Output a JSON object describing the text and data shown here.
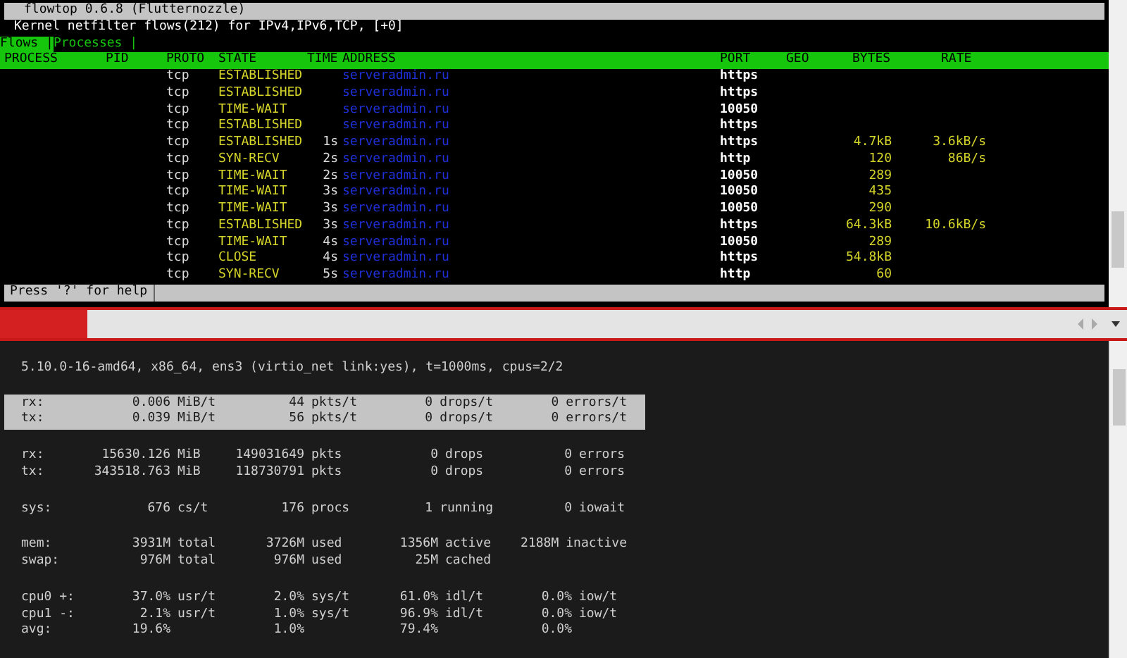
{
  "flowtop": {
    "title": "flowtop 0.6.8 (Flutternozzle)",
    "subtitle": "Kernel netfilter flows(212) for IPv4,IPv6,TCP, [+0]",
    "tabs": [
      {
        "label": "Flows |",
        "selected": true
      },
      {
        "label": "Processes |",
        "selected": false
      }
    ],
    "columns": [
      "PROCESS",
      "PID",
      "PROTO",
      "STATE",
      "TIME",
      "ADDRESS",
      "PORT",
      "GEO",
      "BYTES",
      "RATE"
    ],
    "rows": [
      {
        "proto": "tcp",
        "state": "ESTABLISHED",
        "address": "serveradmin.ru",
        "port": "https"
      },
      {
        "proto": "tcp",
        "state": "ESTABLISHED",
        "address": "serveradmin.ru",
        "port": "https"
      },
      {
        "proto": "tcp",
        "state": "TIME-WAIT",
        "address": "serveradmin.ru",
        "port": "10050"
      },
      {
        "proto": "tcp",
        "state": "ESTABLISHED",
        "address": "serveradmin.ru",
        "port": "https"
      },
      {
        "proto": "tcp",
        "state": "ESTABLISHED",
        "time": "1s",
        "address": "serveradmin.ru",
        "port": "https",
        "bytes": "4.7kB",
        "rate": "3.6kB/s"
      },
      {
        "proto": "tcp",
        "state": "SYN-RECV",
        "time": "2s",
        "address": "serveradmin.ru",
        "port": "http",
        "bytes": "120",
        "rate": "86B/s"
      },
      {
        "proto": "tcp",
        "state": "TIME-WAIT",
        "time": "2s",
        "address": "serveradmin.ru",
        "port": "10050",
        "bytes": "289"
      },
      {
        "proto": "tcp",
        "state": "TIME-WAIT",
        "time": "3s",
        "address": "serveradmin.ru",
        "port": "10050",
        "bytes": "435"
      },
      {
        "proto": "tcp",
        "state": "TIME-WAIT",
        "time": "3s",
        "address": "serveradmin.ru",
        "port": "10050",
        "bytes": "290"
      },
      {
        "proto": "tcp",
        "state": "ESTABLISHED",
        "time": "3s",
        "address": "serveradmin.ru",
        "port": "https",
        "bytes": "64.3kB",
        "rate": "10.6kB/s"
      },
      {
        "proto": "tcp",
        "state": "TIME-WAIT",
        "time": "4s",
        "address": "serveradmin.ru",
        "port": "10050",
        "bytes": "289"
      },
      {
        "proto": "tcp",
        "state": "CLOSE",
        "time": "4s",
        "address": "serveradmin.ru",
        "port": "https",
        "bytes": "54.8kB"
      },
      {
        "proto": "tcp",
        "state": "SYN-RECV",
        "time": "5s",
        "address": "serveradmin.ru",
        "port": "http",
        "bytes": "60"
      }
    ],
    "status": "Press '?' for help"
  },
  "ifpps": {
    "info": "5.10.0-16-amd64, x86_64, ens3 (virtio_net link:yes), t=1000ms, cpus=2/2",
    "groups": [
      {
        "highlighted": true,
        "rows": [
          {
            "label": "rx:",
            "cells": [
              {
                "value": "0.006",
                "unit": "MiB/t"
              },
              {
                "value": "44",
                "unit": "pkts/t"
              },
              {
                "value": "0",
                "unit": "drops/t"
              },
              {
                "value": "0",
                "unit": "errors/t"
              }
            ]
          },
          {
            "label": "tx:",
            "cells": [
              {
                "value": "0.039",
                "unit": "MiB/t"
              },
              {
                "value": "56",
                "unit": "pkts/t"
              },
              {
                "value": "0",
                "unit": "drops/t"
              },
              {
                "value": "0",
                "unit": "errors/t"
              }
            ]
          }
        ]
      },
      {
        "highlighted": false,
        "rows": [
          {
            "label": "rx:",
            "cells": [
              {
                "value": "15630.126",
                "unit": "MiB"
              },
              {
                "value": "149031649",
                "unit": "pkts"
              },
              {
                "value": "0",
                "unit": "drops"
              },
              {
                "value": "0",
                "unit": "errors"
              }
            ]
          },
          {
            "label": "tx:",
            "cells": [
              {
                "value": "343518.763",
                "unit": "MiB"
              },
              {
                "value": "118730791",
                "unit": "pkts"
              },
              {
                "value": "0",
                "unit": "drops"
              },
              {
                "value": "0",
                "unit": "errors"
              }
            ]
          }
        ]
      },
      {
        "highlighted": false,
        "rows": [
          {
            "label": "sys:",
            "cells": [
              {
                "value": "676",
                "unit": "cs/t"
              },
              {
                "value": "176",
                "unit": "procs"
              },
              {
                "value": "1",
                "unit": "running"
              },
              {
                "value": "0",
                "unit": "iowait"
              }
            ]
          }
        ]
      },
      {
        "highlighted": false,
        "rows": [
          {
            "label": "mem:",
            "cells": [
              {
                "value": "3931M",
                "unit": "total"
              },
              {
                "value": "3726M",
                "unit": "used"
              },
              {
                "value": "1356M",
                "unit": "active"
              },
              {
                "value": "2188M",
                "unit": "inactive"
              }
            ]
          },
          {
            "label": "swap:",
            "cells": [
              {
                "value": "976M",
                "unit": "total"
              },
              {
                "value": "976M",
                "unit": "used"
              },
              {
                "value": "25M",
                "unit": "cached"
              }
            ]
          }
        ]
      },
      {
        "highlighted": false,
        "rows": [
          {
            "label": "cpu0 +:",
            "cells": [
              {
                "value": "37.0%",
                "unit": "usr/t"
              },
              {
                "value": "2.0%",
                "unit": "sys/t"
              },
              {
                "value": "61.0%",
                "unit": "idl/t"
              },
              {
                "value": "0.0%",
                "unit": "iow/t"
              }
            ]
          },
          {
            "label": "cpu1 -:",
            "cells": [
              {
                "value": "2.1%",
                "unit": "usr/t"
              },
              {
                "value": "1.0%",
                "unit": "sys/t"
              },
              {
                "value": "96.9%",
                "unit": "idl/t"
              },
              {
                "value": "0.0%",
                "unit": "iow/t"
              }
            ]
          },
          {
            "label": "avg:",
            "cells": [
              {
                "value": "19.6%"
              },
              {
                "value": "1.0%"
              },
              {
                "value": "79.4%"
              },
              {
                "value": "0.0%"
              }
            ]
          }
        ]
      }
    ]
  }
}
